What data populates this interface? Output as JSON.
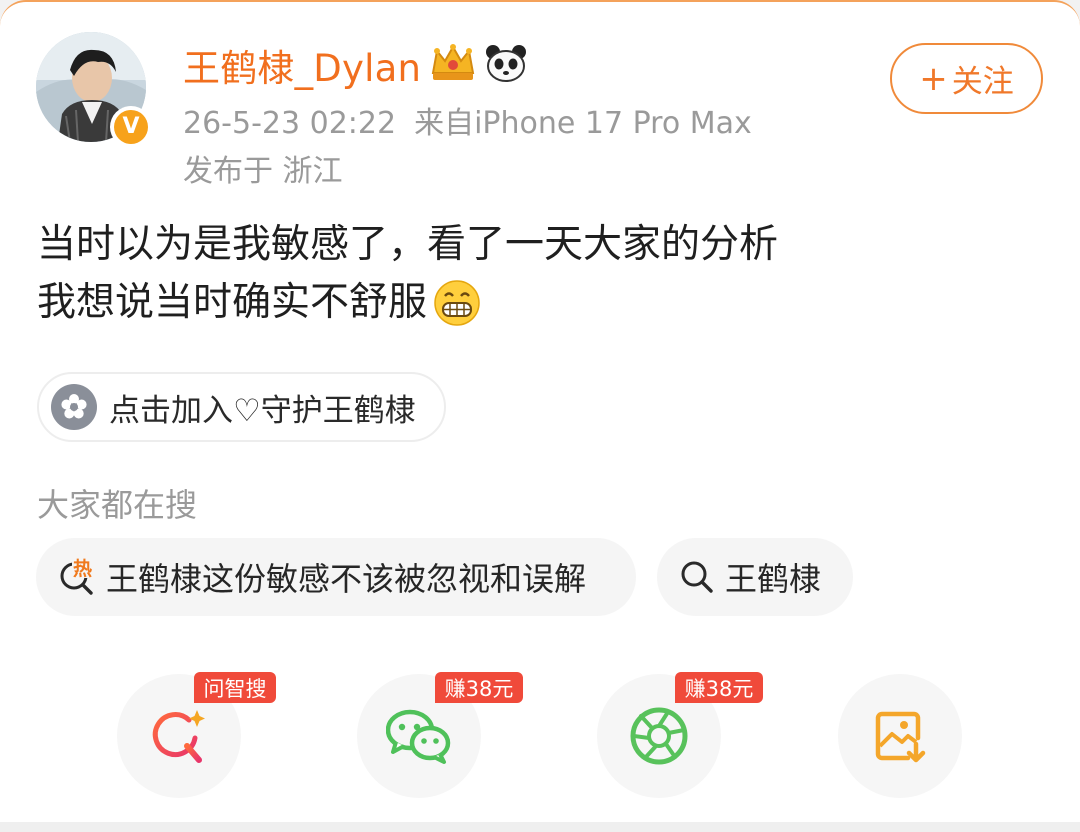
{
  "post": {
    "username": "王鹤棣_Dylan",
    "badge_icons": [
      "crown-emoji-icon",
      "panda-emoji-icon"
    ],
    "verified_badge": "V",
    "date": "26-5-23 02:22",
    "source": "来自iPhone 17 Pro Max",
    "location": "发布于 浙江",
    "content_line1": "当时以为是我敏感了，看了一天大家的分析",
    "content_line2": "我想说当时确实不舒服",
    "content_emoji": "grinning-face-icon"
  },
  "follow_button": {
    "plus": "+",
    "label": "关注"
  },
  "join_pill": {
    "label": "点击加入♡守护王鹤棣"
  },
  "search": {
    "title": "大家都在搜",
    "hot_badge": "热",
    "chips": [
      {
        "label": "王鹤棣这份敏感不该被忽视和误解"
      },
      {
        "label": "王鹤棣"
      }
    ]
  },
  "actions": [
    {
      "icon": "ai-search-icon",
      "tag": "问智搜"
    },
    {
      "icon": "wechat-icon",
      "tag": "赚38元"
    },
    {
      "icon": "moments-icon",
      "tag": "赚38元"
    },
    {
      "icon": "save-image-icon",
      "tag": ""
    }
  ],
  "colors": {
    "username": "#f16f1e",
    "follow_border": "#f08a3a",
    "tag_bg": "#f04a3a",
    "meta_text": "#9a9a9a",
    "wechat_green": "#4fc15a",
    "save_orange": "#f4a62a"
  }
}
